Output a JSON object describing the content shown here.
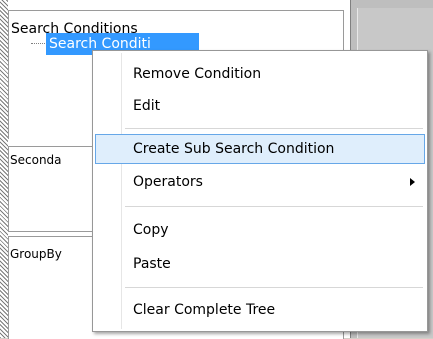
{
  "tree": {
    "sections": {
      "search": "Search Conditions",
      "secondary": "Seconda",
      "groupby": "GroupBy"
    },
    "selected_node": "Search Conditi"
  },
  "context_menu": {
    "items": [
      {
        "label": "Remove Condition"
      },
      {
        "label": "Edit"
      },
      {
        "label": "Create Sub Search Condition"
      },
      {
        "label": "Operators",
        "has_submenu": true
      },
      {
        "label": "Copy"
      },
      {
        "label": "Paste"
      },
      {
        "label": "Clear Complete Tree"
      }
    ],
    "hovered_item": "Create Sub Search Condition"
  },
  "colors": {
    "selection": "#3399ff",
    "menu_hover_fill": "#dfeefc",
    "menu_hover_border": "#66a7e8"
  }
}
